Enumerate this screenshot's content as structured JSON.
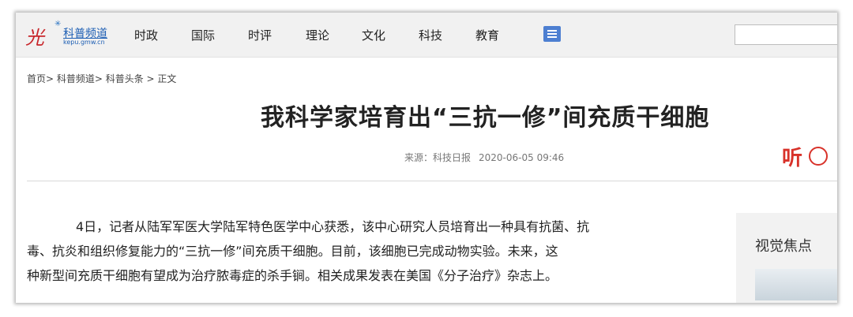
{
  "header": {
    "logo_mark": "光",
    "channel_name": "科普频道",
    "channel_url": "kepu.gmw.cn",
    "nav": [
      "时政",
      "国际",
      "时评",
      "理论",
      "文化",
      "科技",
      "教育"
    ],
    "search_value": ""
  },
  "breadcrumb": "首页> 科普频道> 科普头条 > 正文",
  "article": {
    "title": "我科学家培育出“三抗一修”间充质干细胞",
    "source": "来源：科技日报",
    "datetime": "2020-06-05 09:46",
    "listen_label": "听",
    "paragraph_lines": [
      "4日，记者从陆军军医大学陆军特色医学中心获悉，该中心研究人员培育出一种具有抗菌、抗",
      "毒、抗炎和组织修复能力的“三抗一修”间充质干细胞。目前，该细胞已完成动物实验。未来，这",
      "种新型间充质干细胞有望成为治疗脓毒症的杀手锏。相关成果发表在美国《分子治疗》杂志上。"
    ]
  },
  "sidebar": {
    "heading": "视觉焦点"
  },
  "colors": {
    "accent": "#4d7fd1",
    "listen": "#d8322a",
    "topbar": "#f1f1f1"
  }
}
